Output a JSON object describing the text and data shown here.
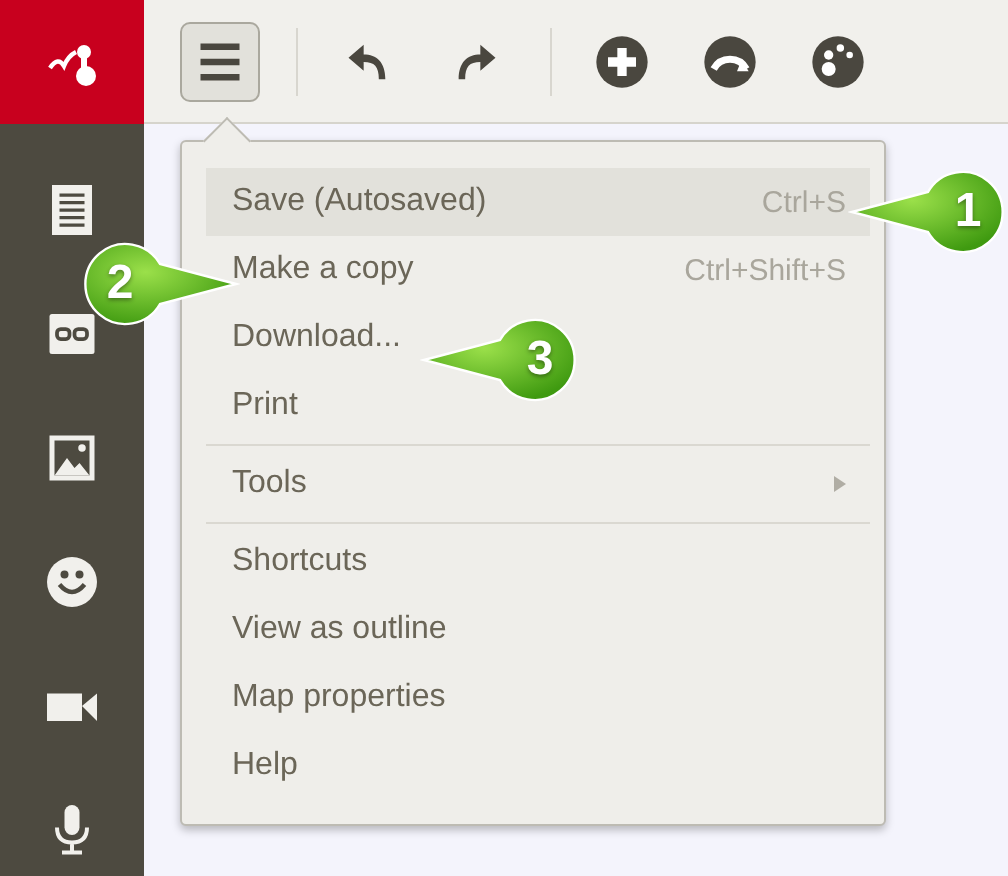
{
  "toolbar": {
    "menu_button": {
      "selected": true
    }
  },
  "menu": {
    "items": [
      {
        "kind": "item",
        "label": "Save (Autosaved)",
        "shortcut": "Ctrl+S",
        "selected": true
      },
      {
        "kind": "item",
        "label": "Make a copy",
        "shortcut": "Ctrl+Shift+S",
        "selected": false
      },
      {
        "kind": "item",
        "label": "Download...",
        "selected": false
      },
      {
        "kind": "item",
        "label": "Print",
        "selected": false
      },
      {
        "kind": "separator"
      },
      {
        "kind": "submenu",
        "label": "Tools",
        "selected": false
      },
      {
        "kind": "separator"
      },
      {
        "kind": "item",
        "label": "Shortcuts",
        "selected": false
      },
      {
        "kind": "item",
        "label": "View as outline",
        "selected": false
      },
      {
        "kind": "item",
        "label": "Map properties",
        "selected": false
      },
      {
        "kind": "item",
        "label": "Help",
        "selected": false
      }
    ]
  },
  "callouts": [
    {
      "label": "1"
    },
    {
      "label": "2"
    },
    {
      "label": "3"
    }
  ]
}
